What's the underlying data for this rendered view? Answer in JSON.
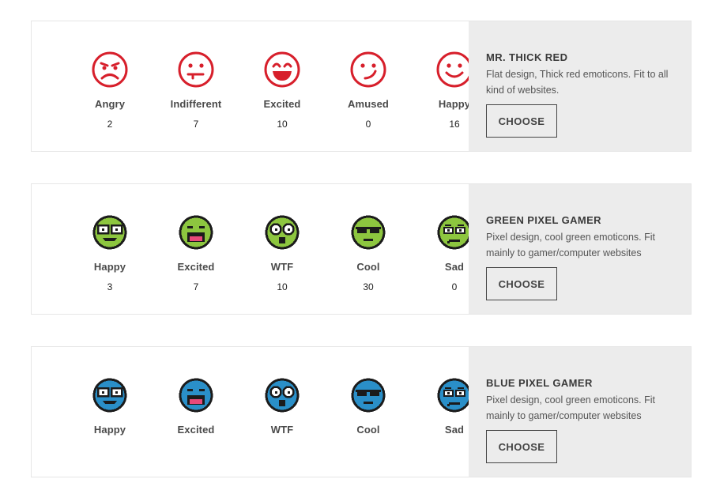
{
  "sets": [
    {
      "title": "MR. THICK RED",
      "description": "Flat design, Thick red emoticons. Fit to all kind of websites.",
      "choose_label": "CHOOSE",
      "emoticons": [
        {
          "label": "Angry",
          "count": "2",
          "icon": "angry-red-icon"
        },
        {
          "label": "Indifferent",
          "count": "7",
          "icon": "indifferent-red-icon"
        },
        {
          "label": "Excited",
          "count": "10",
          "icon": "excited-red-icon"
        },
        {
          "label": "Amused",
          "count": "0",
          "icon": "amused-red-icon"
        },
        {
          "label": "Happy",
          "count": "16",
          "icon": "happy-red-icon"
        }
      ]
    },
    {
      "title": "GREEN PIXEL GAMER",
      "description": "Pixel design, cool green emoticons. Fit mainly to gamer/computer websites",
      "choose_label": "CHOOSE",
      "emoticons": [
        {
          "label": "Happy",
          "count": "3",
          "icon": "happy-green-pixel-icon"
        },
        {
          "label": "Excited",
          "count": "7",
          "icon": "excited-green-pixel-icon"
        },
        {
          "label": "WTF",
          "count": "10",
          "icon": "wtf-green-pixel-icon"
        },
        {
          "label": "Cool",
          "count": "30",
          "icon": "cool-green-pixel-icon"
        },
        {
          "label": "Sad",
          "count": "0",
          "icon": "sad-green-pixel-icon"
        }
      ]
    },
    {
      "title": "BLUE PIXEL GAMER",
      "description": "Pixel design, cool green emoticons. Fit mainly to gamer/computer websites",
      "choose_label": "CHOOSE",
      "emoticons": [
        {
          "label": "Happy",
          "icon": "happy-blue-pixel-icon"
        },
        {
          "label": "Excited",
          "icon": "excited-blue-pixel-icon"
        },
        {
          "label": "WTF",
          "icon": "wtf-blue-pixel-icon"
        },
        {
          "label": "Cool",
          "icon": "cool-blue-pixel-icon"
        },
        {
          "label": "Sad",
          "icon": "sad-blue-pixel-icon"
        }
      ]
    }
  ],
  "colors": {
    "red": "#d71f2b",
    "green": "#8dc63f",
    "blue": "#2a8fc8",
    "outline": "#1b1b1b",
    "panel": "#ececec"
  }
}
